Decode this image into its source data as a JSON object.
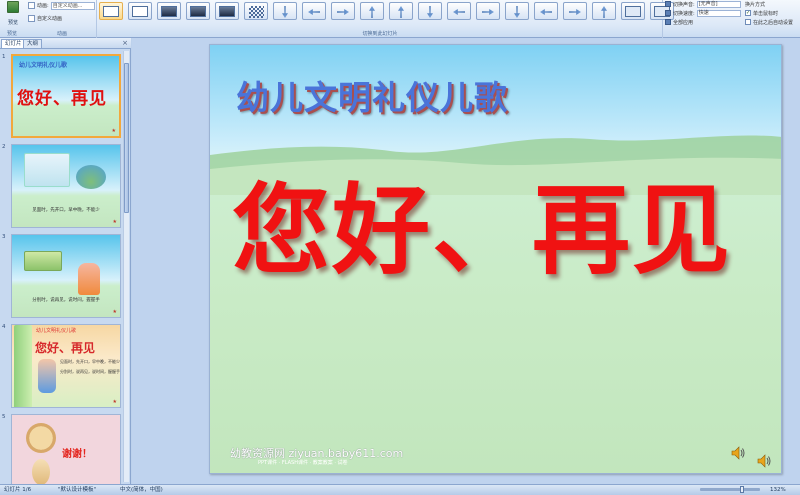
{
  "ribbon": {
    "preview_label": "预览",
    "preview_group_label": "预览",
    "animation_group_label": "动画",
    "anim_row1_label": "动画:",
    "anim_row1_value": "自定义动画...",
    "anim_row2_label": "自定义动画",
    "transitions_group_label": "切换到此幻灯片",
    "transition_sound_label": "切换声音:",
    "transition_sound_value": "[无声音]",
    "transition_speed_label": "切换速度:",
    "transition_speed_value": "快速",
    "apply_all_label": "全部应用",
    "advance_header": "换片方式",
    "on_click_label": "单击鼠标时",
    "on_click_checked": "✓",
    "after_label": "在此之后自动设置"
  },
  "pane": {
    "tab_slides": "幻灯片",
    "tab_outline": "大纲",
    "close": "×"
  },
  "thumbnails": [
    {
      "num": "1",
      "title": "幼儿文明礼仪儿歌",
      "headline": "您好、再见"
    },
    {
      "num": "2",
      "caption": "见面时，先开口，早中晚，不能少"
    },
    {
      "num": "3",
      "caption": "分别时，说再见，说时间，握握手"
    },
    {
      "num": "4",
      "title": "幼儿文明礼仪儿歌",
      "headline": "您好、再见",
      "line1": "见面时，先开口，早中晚，不能少",
      "line2": "分别时，说再见，说时间，握握手"
    },
    {
      "num": "5",
      "text": "谢谢！"
    }
  ],
  "slide": {
    "title": "幼儿文明礼仪儿歌",
    "headline": "您好、再见",
    "watermark": "幼教资源网 ziyuan.baby611.com",
    "watermark_sub": "PPT课件 · FLASH课件 · 教案教案 · 试卷"
  },
  "status": {
    "slide_pos": "幻灯片 1/6",
    "theme": "\"默认设计模板\"",
    "language": "中文(简体，中国)",
    "zoom": "132%"
  },
  "icons": {
    "speaker": "speaker-icon",
    "close": "close-icon",
    "preview": "preview-icon"
  },
  "colors": {
    "title": "#4a74d9",
    "headline": "#f01212",
    "ribbon": "#dce8f7",
    "selection": "#f2a83c"
  }
}
